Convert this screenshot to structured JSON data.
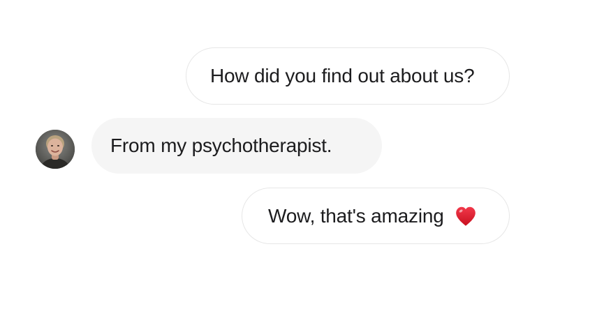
{
  "conversation": {
    "messages": [
      {
        "sender": "me",
        "text": "How did you find out about us?"
      },
      {
        "sender": "them",
        "text": "From my psychotherapist."
      },
      {
        "sender": "me",
        "text": "Wow, that's amazing",
        "emoji": "heart-icon"
      }
    ]
  },
  "colors": {
    "outgoing_bg": "#ffffff",
    "outgoing_border": "#e6e6e6",
    "incoming_bg": "#f5f5f5",
    "text": "#1c1c1e",
    "heart": "#e0182d"
  }
}
